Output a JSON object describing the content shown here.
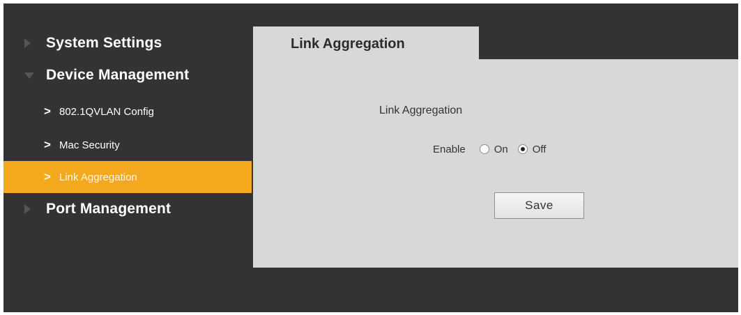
{
  "sidebar": {
    "groups": [
      {
        "label": "System Settings",
        "icon": "triangle-right-icon",
        "expanded": false
      },
      {
        "label": "Device Management",
        "icon": "triangle-down-icon",
        "expanded": true
      },
      {
        "label": "Port Management",
        "icon": "triangle-right-icon",
        "expanded": false
      }
    ],
    "device_management_items": [
      {
        "label": "802.1QVLAN Config",
        "icon": "chevron-right-icon",
        "chevron": ">",
        "active": false
      },
      {
        "label": "Mac Security",
        "icon": "chevron-right-icon",
        "chevron": ">",
        "active": false
      },
      {
        "label": "Link Aggregation",
        "icon": "chevron-right-icon",
        "chevron": ">",
        "active": true
      }
    ]
  },
  "tab": {
    "label": "Link Aggregation"
  },
  "form": {
    "section_title": "Link Aggregation",
    "enable_label": "Enable",
    "options": [
      {
        "label": "On",
        "checked": false
      },
      {
        "label": "Off",
        "checked": true
      }
    ],
    "save_label": "Save"
  },
  "colors": {
    "background": "#333333",
    "panel": "#d8d8d8",
    "active_item": "#f4a81e",
    "text_light": "#ffffff",
    "text_dark": "#333333"
  }
}
